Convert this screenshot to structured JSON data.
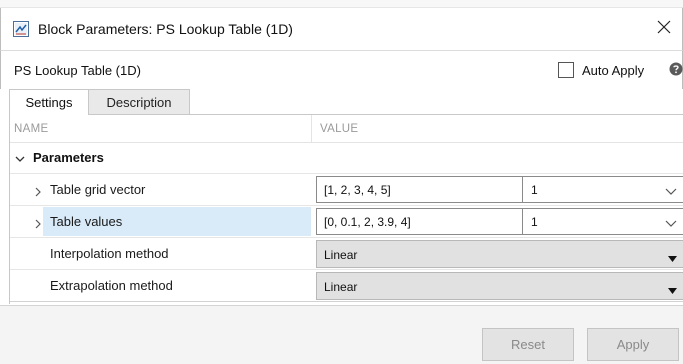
{
  "window": {
    "title": "Block Parameters: PS Lookup Table (1D)",
    "icons": {
      "app": "simulink-block-icon",
      "close": "close-icon"
    }
  },
  "blockbar": {
    "block_name": "PS Lookup Table (1D)",
    "auto_apply_label": "Auto Apply",
    "auto_apply_checked": false,
    "help_icon": "help-icon"
  },
  "tabs": [
    {
      "label": "Settings",
      "active": true
    },
    {
      "label": "Description",
      "active": false
    }
  ],
  "table": {
    "headers": {
      "name": "NAME",
      "value": "VALUE"
    },
    "section": {
      "label": "Parameters",
      "expanded": true
    },
    "rows": [
      {
        "label": "Table grid vector",
        "value": "[1, 2, 3, 4, 5]",
        "unit": "1",
        "type": "text-unit",
        "expandable": true,
        "selected": false
      },
      {
        "label": "Table values",
        "value": "[0, 0.1, 2, 3.9, 4]",
        "unit": "1",
        "type": "text-unit",
        "expandable": true,
        "selected": true
      },
      {
        "label": "Interpolation method",
        "value": "Linear",
        "type": "select",
        "expandable": false,
        "selected": false
      },
      {
        "label": "Extrapolation method",
        "value": "Linear",
        "type": "select",
        "expandable": false,
        "selected": false
      }
    ]
  },
  "footer": {
    "reset_label": "Reset",
    "apply_label": "Apply"
  },
  "colors": {
    "selection": "#d9ebf9",
    "disabled_text": "#8a8a8a",
    "header_text": "#9a9a9a"
  }
}
